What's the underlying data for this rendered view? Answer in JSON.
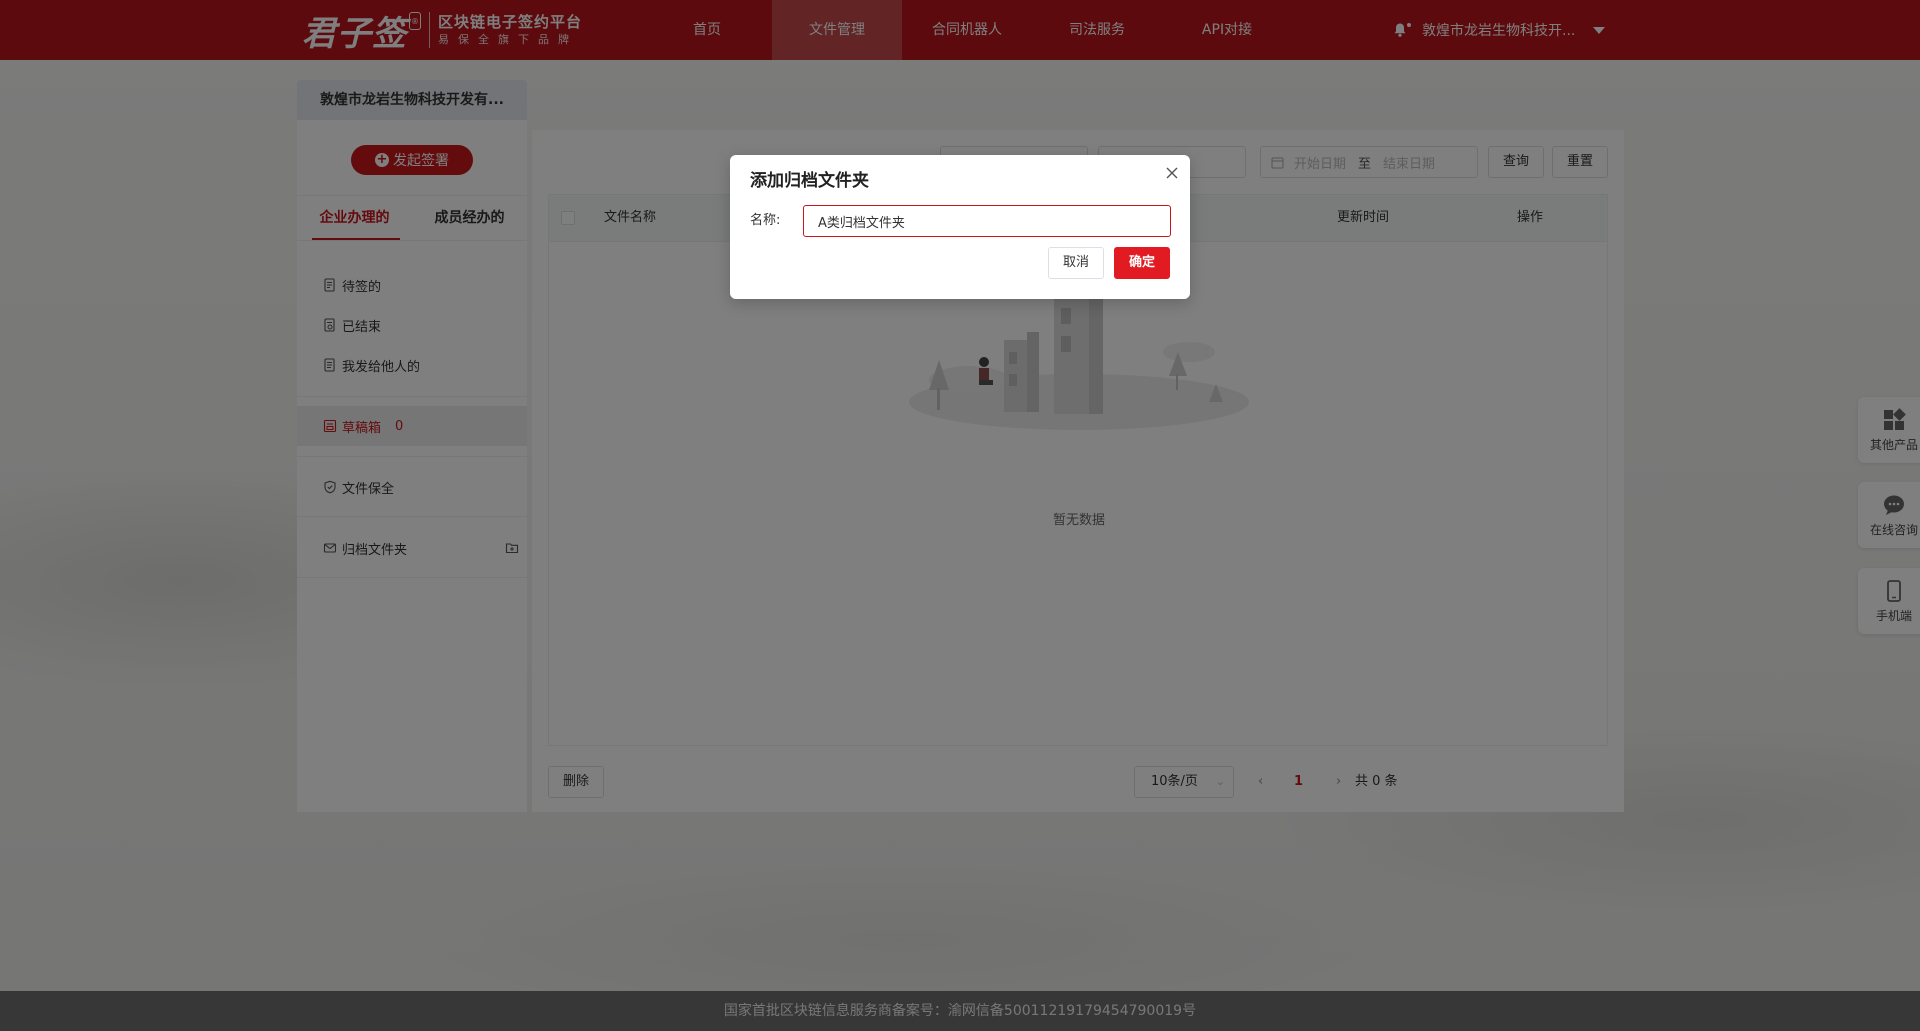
{
  "header": {
    "logo_main": "君子签",
    "logo_badge": "®",
    "logo_line1": "区块链电子签约平台",
    "logo_line2": "易保全旗下品牌",
    "nav": [
      "首页",
      "文件管理",
      "合同机器人",
      "司法服务",
      "API对接"
    ],
    "active_nav_index": 1,
    "user_name": "敦煌市龙岩生物科技开..."
  },
  "company_tab": "敦煌市龙岩生物科技开发有...",
  "sidebar": {
    "start_button": "发起签署",
    "tabs": [
      "企业办理的",
      "成员经办的"
    ],
    "active_tab_index": 0,
    "menu": {
      "pending": "待签的",
      "finished": "已结束",
      "sent": "我发给他人的",
      "drafts": "草稿箱",
      "drafts_count": "0",
      "preservation": "文件保全",
      "archive": "归档文件夹"
    }
  },
  "main": {
    "date_start_placeholder": "开始日期",
    "date_separator": "至",
    "date_end_placeholder": "结束日期",
    "query_button": "查询",
    "reset_button": "重置",
    "columns": {
      "name": "文件名称",
      "updated": "更新时间",
      "actions": "操作"
    },
    "empty_text": "暂无数据",
    "delete_button": "删除",
    "page_size": "10条/页",
    "current_page": "1",
    "total": "共 0 条"
  },
  "float_widgets": [
    "其他产品",
    "在线咨询",
    "手机端"
  ],
  "footer": "国家首批区块链信息服务商备案号：渝网信备50011219179454790019号",
  "modal": {
    "title": "添加归档文件夹",
    "name_label": "名称:",
    "name_value": "A类归档文件夹",
    "cancel_button": "取消",
    "ok_button": "确定"
  },
  "colors": {
    "brand_red": "#b8151b",
    "accent_red": "#c8161d",
    "confirm_red": "#e21b22"
  }
}
